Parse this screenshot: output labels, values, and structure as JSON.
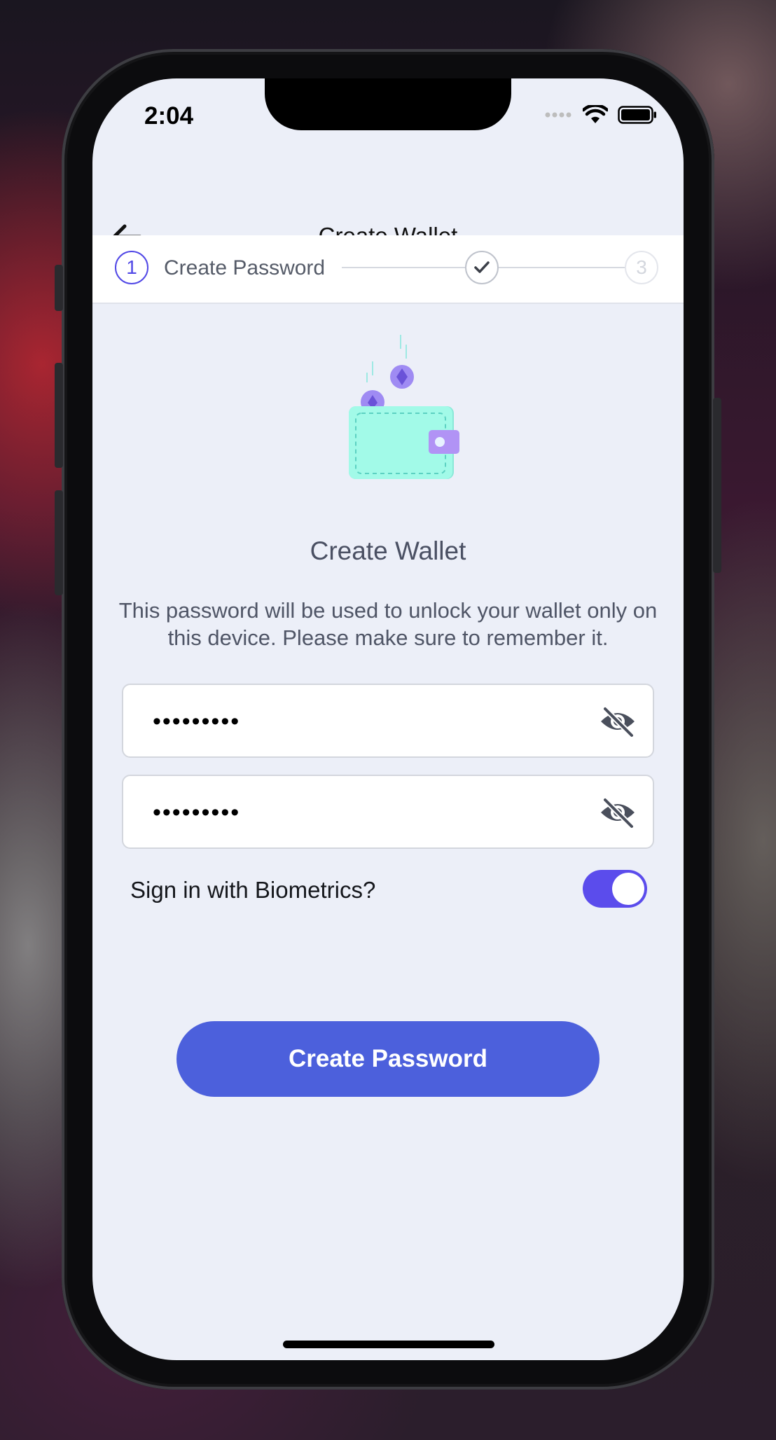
{
  "status_bar": {
    "time": "2:04"
  },
  "nav": {
    "title": "Create Wallet",
    "back_icon": "arrow-left-icon"
  },
  "stepper": {
    "steps": [
      {
        "number": "1",
        "label": "Create Password",
        "state": "active"
      },
      {
        "number": "",
        "state": "completed"
      },
      {
        "number": "3",
        "state": "upcoming"
      }
    ],
    "active_color": "#5148e6"
  },
  "main": {
    "illustration": "wallet-with-coins",
    "heading": "Create Wallet",
    "description": "This password will be used to unlock your wallet only on this device. Please make sure to remember it.",
    "password": {
      "value": "•••••••••"
    },
    "confirm_password": {
      "value": "•••••••••"
    },
    "biometrics": {
      "label": "Sign in with Biometrics?",
      "enabled": true
    },
    "submit_label": "Create Password"
  },
  "colors": {
    "accent": "#4c60dc",
    "toggle_on": "#5b4cec",
    "background": "#eceff8"
  }
}
